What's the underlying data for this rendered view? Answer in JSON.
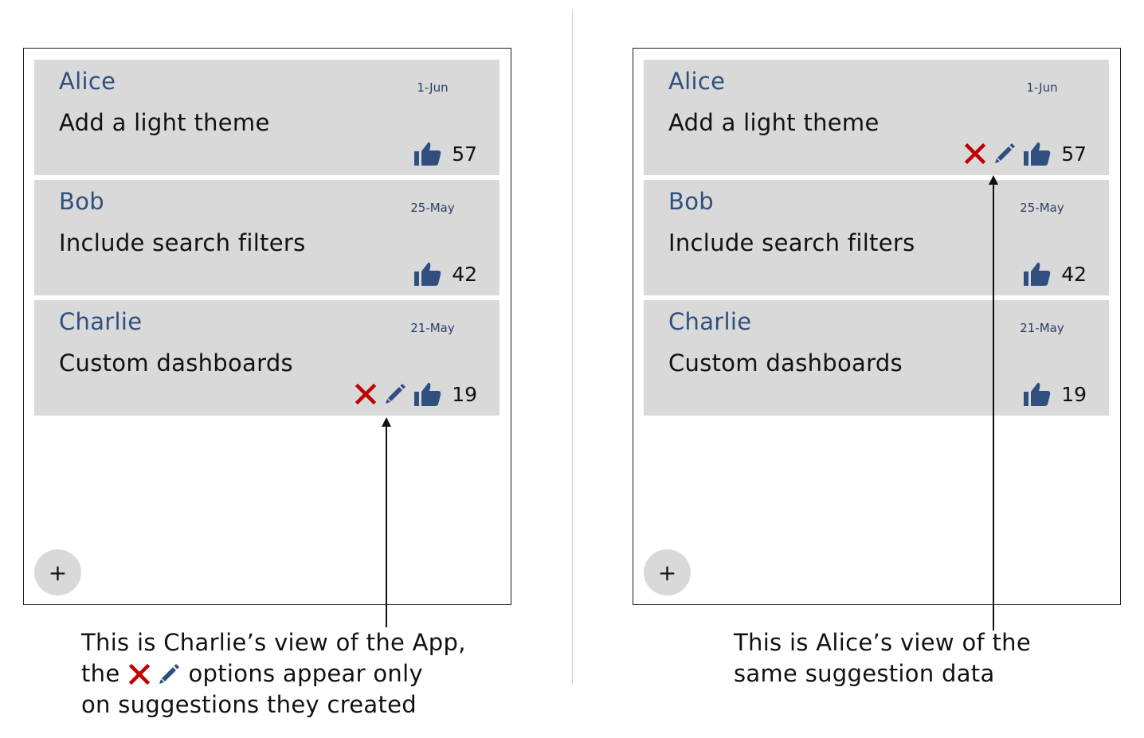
{
  "left_panel": {
    "cards": [
      {
        "author": "Alice",
        "date": "1-Jun",
        "text": "Add a light theme",
        "votes": "57",
        "show_edit": false
      },
      {
        "author": "Bob",
        "date": "25-May",
        "text": "Include search filters",
        "votes": "42",
        "show_edit": false
      },
      {
        "author": "Charlie",
        "date": "21-May",
        "text": "Custom dashboards",
        "votes": "19",
        "show_edit": true
      }
    ],
    "add_label": "+"
  },
  "right_panel": {
    "cards": [
      {
        "author": "Alice",
        "date": "1-Jun",
        "text": "Add a light theme",
        "votes": "57",
        "show_edit": true
      },
      {
        "author": "Bob",
        "date": "25-May",
        "text": "Include search filters",
        "votes": "42",
        "show_edit": false
      },
      {
        "author": "Charlie",
        "date": "21-May",
        "text": "Custom dashboards",
        "votes": "19",
        "show_edit": false
      }
    ],
    "add_label": "+"
  },
  "captions": {
    "left": {
      "line1": "This is Charlie’s view of the App,",
      "line2_before": "the",
      "line2_after": "options appear only",
      "line3": "on suggestions they created"
    },
    "right": {
      "line1": "This is Alice’s view of the",
      "line2": "same suggestion data"
    }
  },
  "colors": {
    "card_bg": "#d9d9d9",
    "author": "#2f4f7f",
    "delete": "#c00000",
    "icon_blue": "#2f4f7f"
  },
  "icons": [
    "delete-x-icon",
    "pencil-icon",
    "thumbs-up-icon",
    "plus-icon"
  ]
}
